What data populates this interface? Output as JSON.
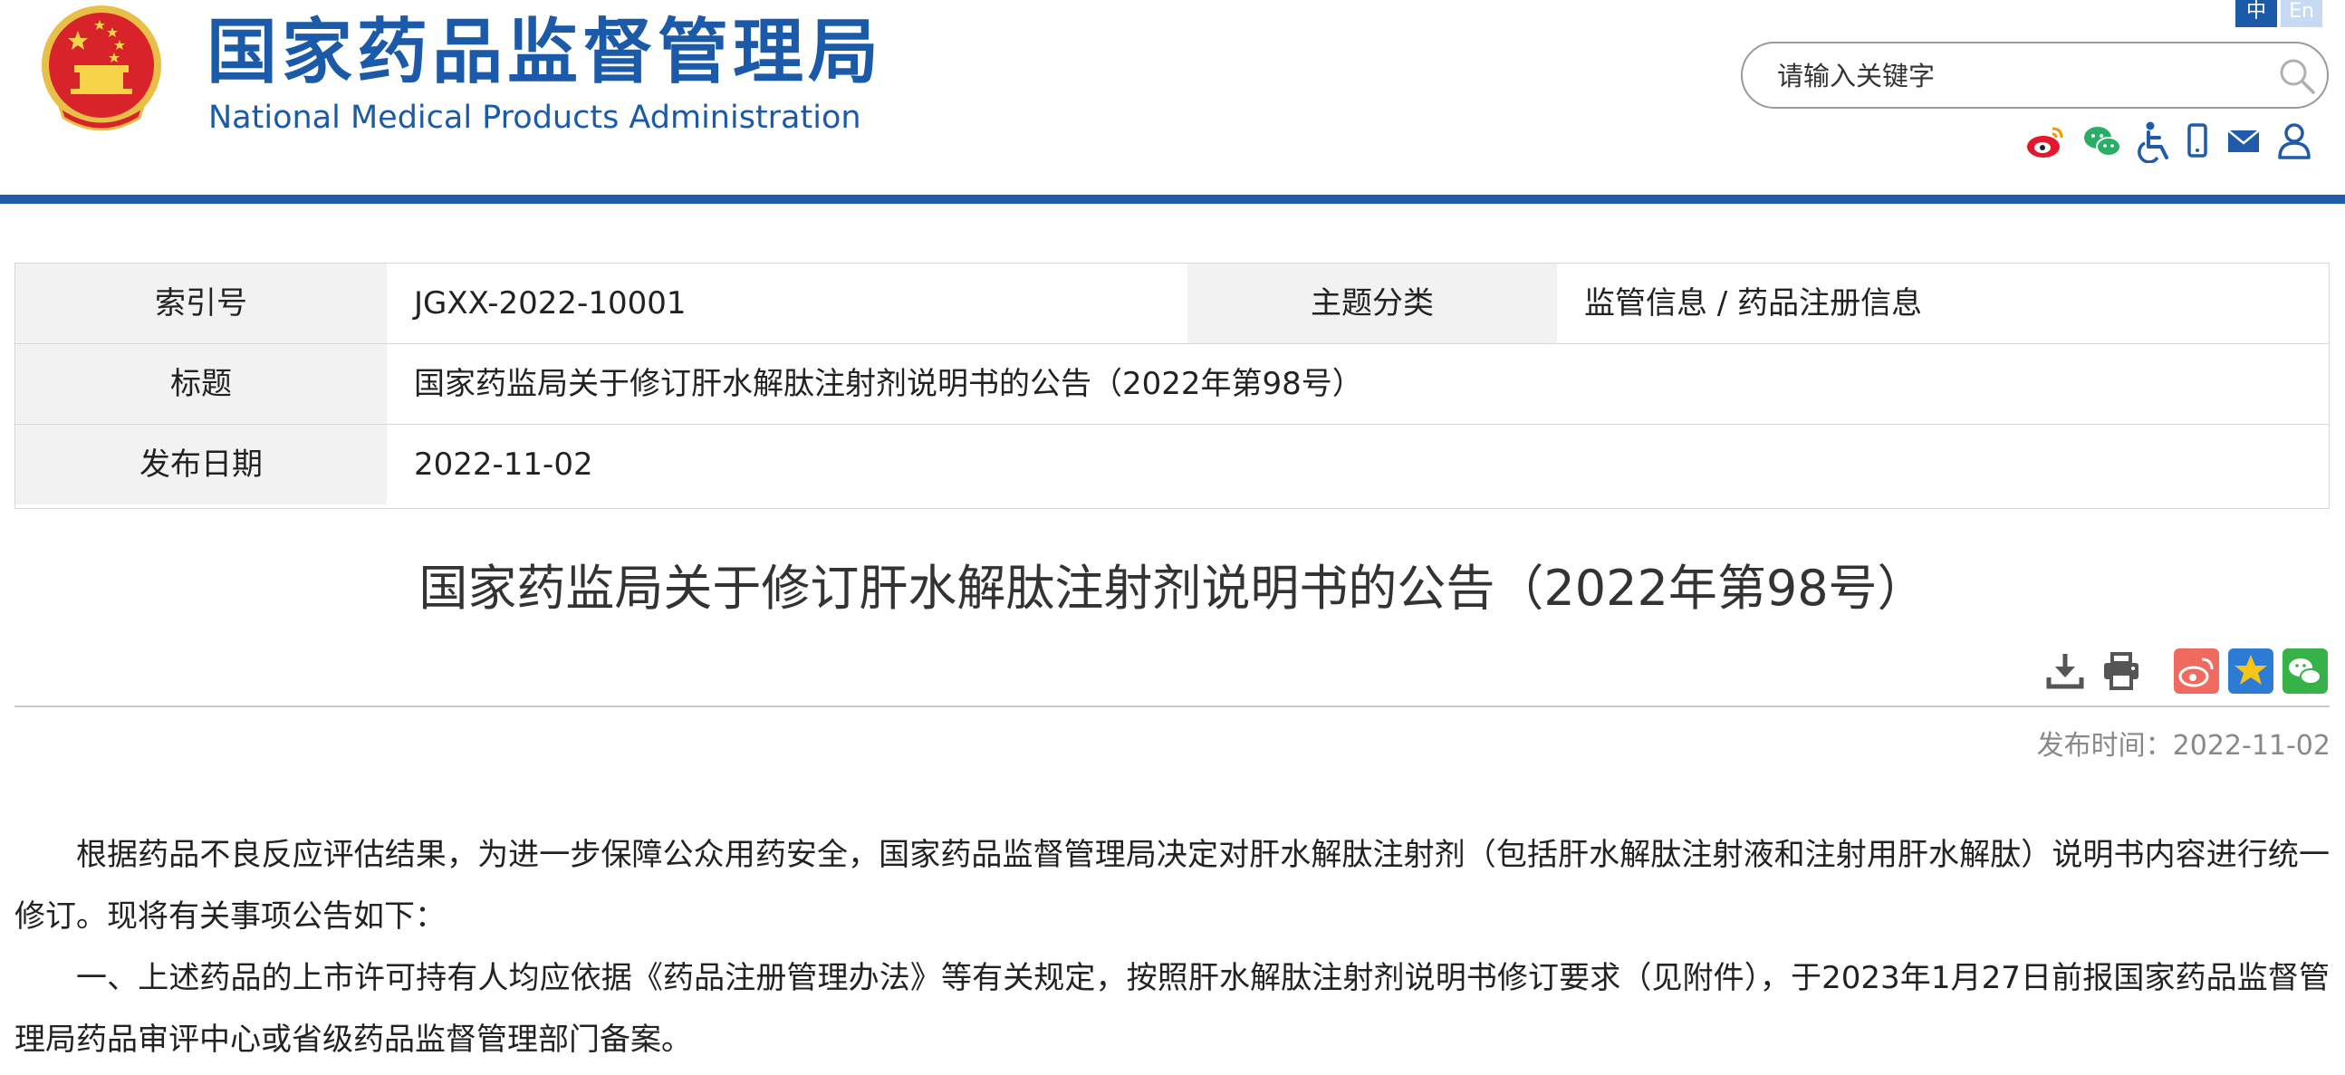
{
  "header": {
    "brand_cn": "国家药品监督管理局",
    "brand_en": "National Medical Products Administration",
    "lang_zh": "中",
    "lang_en": "En",
    "search_placeholder": "请输入关键字",
    "icons": [
      "emblem-icon",
      "weibo-icon",
      "wechat-icon",
      "accessibility-icon",
      "mobile-icon",
      "mail-icon",
      "user-icon",
      "search-icon"
    ],
    "accent_color": "#1f5ba8"
  },
  "info": {
    "index_label": "索引号",
    "index_value": "JGXX-2022-10001",
    "topic_label": "主题分类",
    "topic_value": "监管信息 / 药品注册信息",
    "title_label": "标题",
    "title_value": "国家药监局关于修订肝水解肽注射剂说明书的公告（2022年第98号）",
    "date_label": "发布日期",
    "date_value": "2022-11-02"
  },
  "article": {
    "title": "国家药监局关于修订肝水解肽注射剂说明书的公告（2022年第98号）",
    "publish_time": "发布时间：2022-11-02",
    "tools": [
      "download-icon",
      "print-icon",
      "share-weibo-icon",
      "favorite-star-icon",
      "share-wechat-icon"
    ],
    "paragraphs": [
      "根据药品不良反应评估结果，为进一步保障公众用药安全，国家药品监督管理局决定对肝水解肽注射剂（包括肝水解肽注射液和注射用肝水解肽）说明书内容进行统一修订。现将有关事项公告如下：",
      "一、上述药品的上市许可持有人均应依据《药品注册管理办法》等有关规定，按照肝水解肽注射剂说明书修订要求（见附件），于2023年1月27日前报国家药品监督管理局药品审评中心或省级药品监督管理部门备案。"
    ]
  }
}
